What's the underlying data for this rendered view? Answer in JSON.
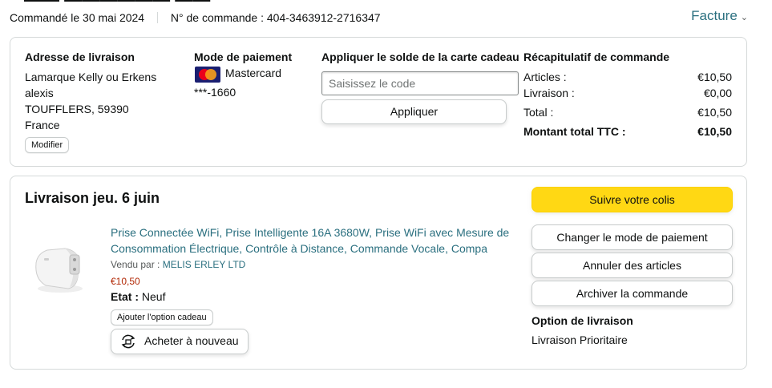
{
  "order": {
    "date_label": "Commandé le 30 mai 2024",
    "number_label": "N° de commande : 404-3463912-2716347",
    "invoice_label": "Facture"
  },
  "shipping": {
    "title": "Adresse de livraison",
    "lines": [
      "Lamarque Kelly ou Erkens",
      "alexis",
      "TOUFFLERS, 59390",
      "France"
    ],
    "modify_label": "Modifier"
  },
  "payment": {
    "title": "Mode de paiement",
    "card_name": "Mastercard",
    "card_number": "***-1660"
  },
  "gift_card": {
    "title": "Appliquer le solde de la carte cadeau",
    "placeholder": "Saisissez le code",
    "apply_label": "Appliquer"
  },
  "summary": {
    "title": "Récapitulatif de commande",
    "rows": [
      {
        "label": "Articles :",
        "value": "€10,50"
      },
      {
        "label": "Livraison :",
        "value": "€0,00"
      },
      {
        "label": "Total :",
        "value": "€10,50"
      },
      {
        "label": "Montant total TTC :",
        "value": "€10,50"
      }
    ]
  },
  "delivery": {
    "title": "Livraison jeu. 6 juin",
    "product_title": "Prise Connectée WiFi, Prise Intelligente 16A 3680W, Prise WiFi avec Mesure de Consommation Électrique, Contrôle à Distance, Commande Vocale, Compa",
    "seller_prefix": "Vendu par :",
    "seller_name": "MELIS ERLEY LTD",
    "price": "€10,50",
    "condition_label": "Etat :",
    "condition_value": "Neuf",
    "gift_option_label": "Ajouter l'option cadeau",
    "buy_again_label": "Acheter à nouveau"
  },
  "actions": {
    "track": "Suivre votre colis",
    "change_payment": "Changer le mode de paiement",
    "cancel": "Annuler des articles",
    "archive": "Archiver la commande",
    "shipping_option_title": "Option de livraison",
    "shipping_option_value": "Livraison Prioritaire"
  },
  "colors": {
    "link": "#2a6f7f",
    "price": "#b12704",
    "primary_button": "#ffd814"
  }
}
